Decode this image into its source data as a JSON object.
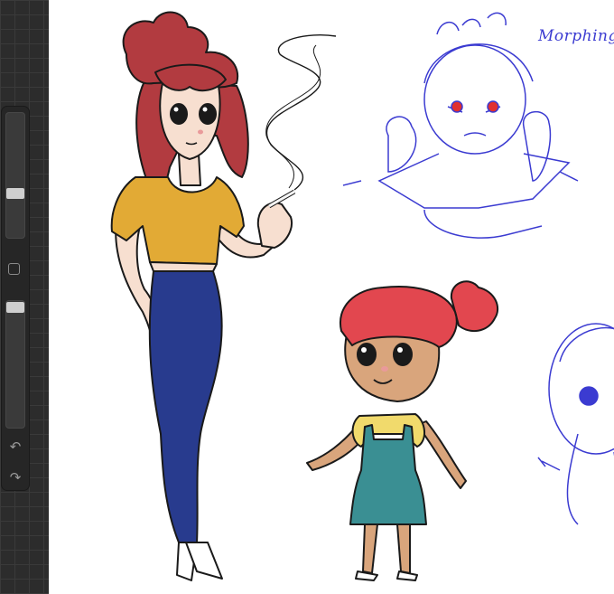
{
  "app": {
    "sidebar": {
      "tools": [
        {
          "name": "brush-size-slider",
          "value": 0.62
        },
        {
          "name": "modify-button",
          "icon": "square-icon"
        },
        {
          "name": "opacity-slider",
          "value": 1.0
        },
        {
          "name": "undo-button",
          "icon": "undo-icon",
          "glyph": "↶"
        },
        {
          "name": "redo-button",
          "icon": "redo-icon",
          "glyph": "↷"
        }
      ]
    },
    "canvas": {
      "sketch_label": "Morphing",
      "colors": {
        "hair": "#b23b40",
        "hair_girl": "#e2474f",
        "skin": "#f7dfd0",
        "skin_girl": "#d9a57c",
        "shirt": "#e2aa35",
        "jeans": "#283b8e",
        "overall": "#3a8f93",
        "girl_shirt": "#f1da6c",
        "sketch": "#3b3bd1",
        "eye_red": "#e03030"
      }
    }
  }
}
